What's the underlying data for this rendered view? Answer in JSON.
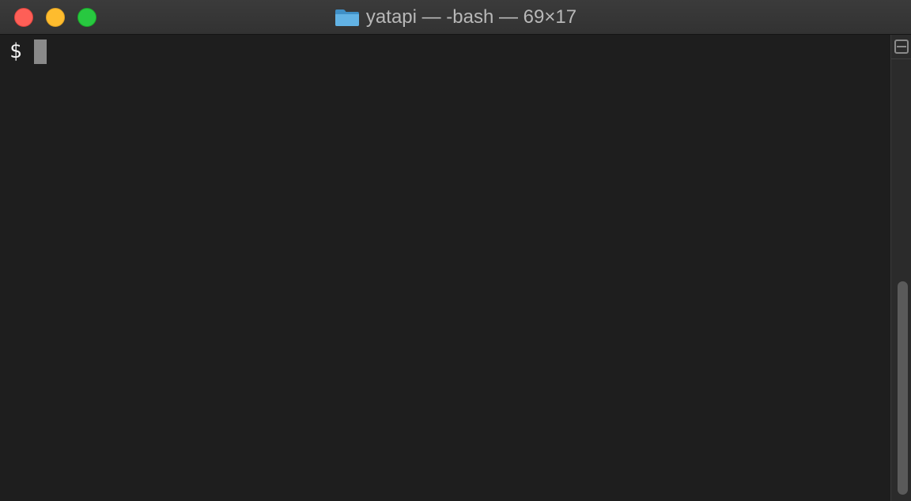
{
  "window": {
    "title": "yatapi — -bash — 69×17",
    "folder_icon": "folder-icon",
    "colors": {
      "close": "#fe5f57",
      "minimize": "#febc2e",
      "zoom": "#28c840",
      "background": "#1e1e1e"
    }
  },
  "terminal": {
    "prompt": "$",
    "cursor_icon": "block-cursor"
  },
  "scrollbar": {
    "split_icon": "split-pane-icon"
  }
}
